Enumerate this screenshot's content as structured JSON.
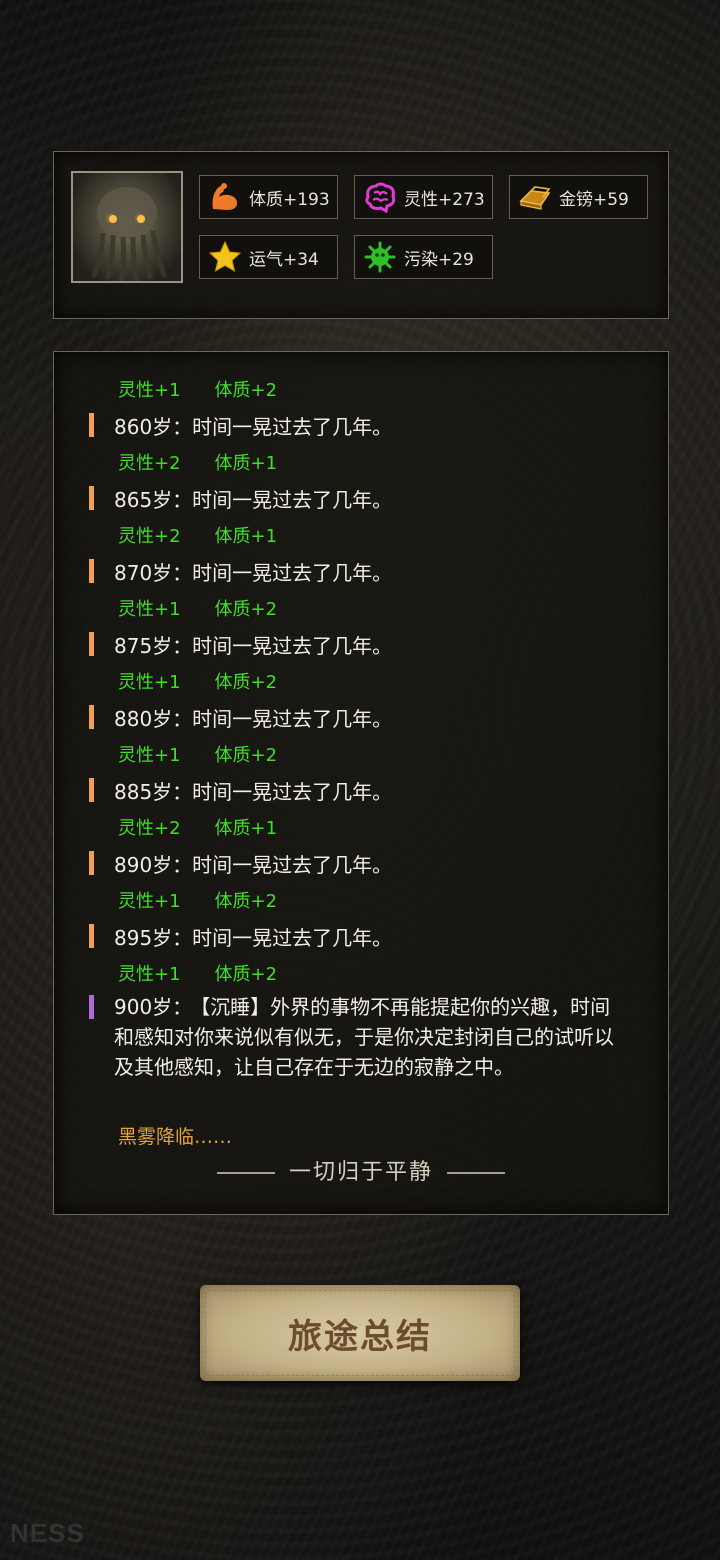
{
  "stats": [
    {
      "label": "体质+193",
      "icon": "muscle-arm-icon",
      "color": "#f07a2a"
    },
    {
      "label": "灵性+273",
      "icon": "brain-icon",
      "color": "#e53ad6"
    },
    {
      "label": "金镑+59",
      "icon": "gold-bars-icon",
      "color": "#e7a62c"
    },
    {
      "label": "运气+34",
      "icon": "star-icon",
      "color": "#f4c21c"
    },
    {
      "label": "污染+29",
      "icon": "virus-icon",
      "color": "#2ec026"
    }
  ],
  "log": {
    "top_gain": {
      "a": "灵性+1",
      "b": "体质+2"
    },
    "entries": [
      {
        "text": "860岁：时间一晃过去了几年。",
        "a": "灵性+2",
        "b": "体质+1"
      },
      {
        "text": "865岁：时间一晃过去了几年。",
        "a": "灵性+2",
        "b": "体质+1"
      },
      {
        "text": "870岁：时间一晃过去了几年。",
        "a": "灵性+1",
        "b": "体质+2"
      },
      {
        "text": "875岁：时间一晃过去了几年。",
        "a": "灵性+1",
        "b": "体质+2"
      },
      {
        "text": "880岁：时间一晃过去了几年。",
        "a": "灵性+1",
        "b": "体质+2"
      },
      {
        "text": "885岁：时间一晃过去了几年。",
        "a": "灵性+2",
        "b": "体质+1"
      },
      {
        "text": "890岁：时间一晃过去了几年。",
        "a": "灵性+1",
        "b": "体质+2"
      },
      {
        "text": "895岁：时间一晃过去了几年。",
        "a": "灵性+1",
        "b": "体质+2"
      }
    ],
    "final_age": "900岁：",
    "final_text": "【沉睡】外界的事物不再能提起你的兴趣，时间和感知对你来说似有似无，于是你决定封闭自己的试听以及其他感知，让自己存在于无边的寂静之中。",
    "fog": "黑雾降临……",
    "ending": "一切归于平静"
  },
  "summary_button": "旅途总结",
  "watermark": "NESS"
}
